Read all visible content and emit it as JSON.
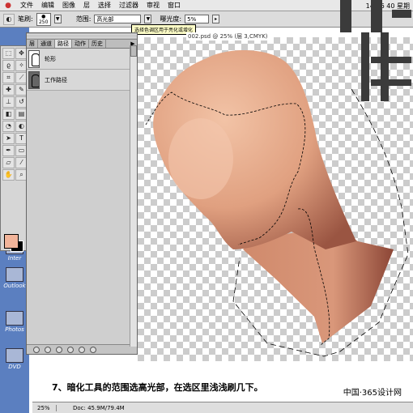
{
  "menubar": {
    "items": [
      "文件",
      "编辑",
      "图像",
      "层",
      "选择",
      "过滤器",
      "审视",
      "窗口"
    ],
    "clock": "14:06 40 星期"
  },
  "options": {
    "tool_label": "笔刷:",
    "brush_size": "250",
    "range_label": "范围:",
    "range_value": "高光部",
    "exposure_label": "曝光度:",
    "exposure_value": "5%",
    "tooltip": "选择色调区用于亮化或增化"
  },
  "paths_panel": {
    "tabs": [
      "层",
      "通道",
      "路径",
      "动作",
      "历史"
    ],
    "active_tab": "路径",
    "items": [
      {
        "name": "轮形"
      },
      {
        "name": "工作路径"
      }
    ]
  },
  "document": {
    "title": "002.psd @ 25% (层 3,CMYK)",
    "zoom": "25%",
    "doc_size": "Doc: 45.9M/79.4M"
  },
  "desktop": {
    "icons": [
      "Inter",
      "Outlook",
      "Photos",
      "DVD"
    ]
  },
  "caption": {
    "text": "7、暗化工具的范围选高光部，在选区里浅浅刷几下。",
    "site": "中国·365设计网"
  },
  "colors": {
    "foreground": "#f2b49a",
    "background": "#000000",
    "skin_light": "#eab396",
    "skin_dark": "#8e4a38"
  },
  "icons": {
    "apple": "apple-icon"
  }
}
